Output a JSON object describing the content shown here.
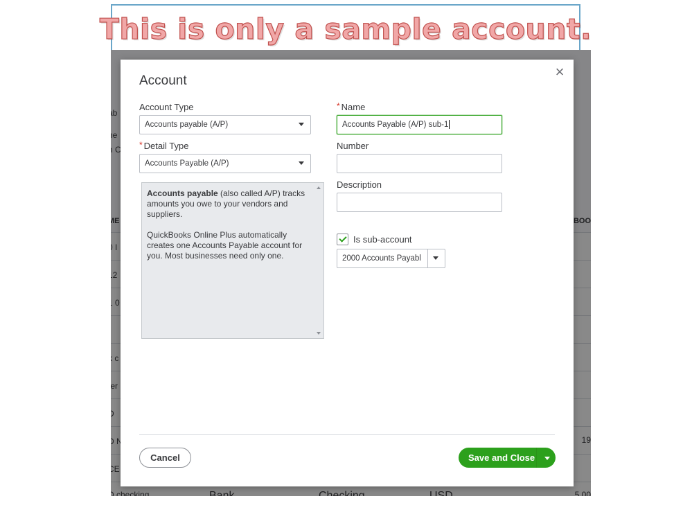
{
  "banner": {
    "text": "This is only a sample account."
  },
  "background": {
    "left_fragments": [
      "ab",
      "ne",
      "n C",
      "ME",
      "0 I",
      "12",
      "1 0",
      "k c",
      "ter",
      "D",
      "D N",
      "CE",
      "D checking"
    ],
    "right_fragments": [
      "KBOO",
      "19",
      "5.00"
    ],
    "last_row": [
      "Bank",
      "Checking",
      "USD"
    ]
  },
  "modal": {
    "title": "Account",
    "account_type": {
      "label": "Account Type",
      "value": "Accounts payable (A/P)"
    },
    "detail_type": {
      "label": "Detail Type",
      "required_mark": "*",
      "value": "Accounts Payable (A/P)"
    },
    "description_panel": {
      "bold": "Accounts payable",
      "rest": " (also called A/P) tracks amounts you owe to your vendors and suppliers.",
      "paragraph2": "QuickBooks Online Plus automatically creates one Accounts Payable account for you. Most businesses need only one."
    },
    "name": {
      "label": "Name",
      "required_mark": "*",
      "value": "Accounts Payable (A/P) sub-1"
    },
    "number": {
      "label": "Number",
      "value": ""
    },
    "description": {
      "label": "Description",
      "value": ""
    },
    "sub_account": {
      "label": "Is sub-account",
      "checked": true,
      "parent": "2000 Accounts Payabl"
    },
    "buttons": {
      "cancel": "Cancel",
      "save": "Save and Close"
    },
    "close_icon": "close-icon"
  },
  "colors": {
    "accent": "#2ca01c",
    "required": "#d52b1e"
  }
}
